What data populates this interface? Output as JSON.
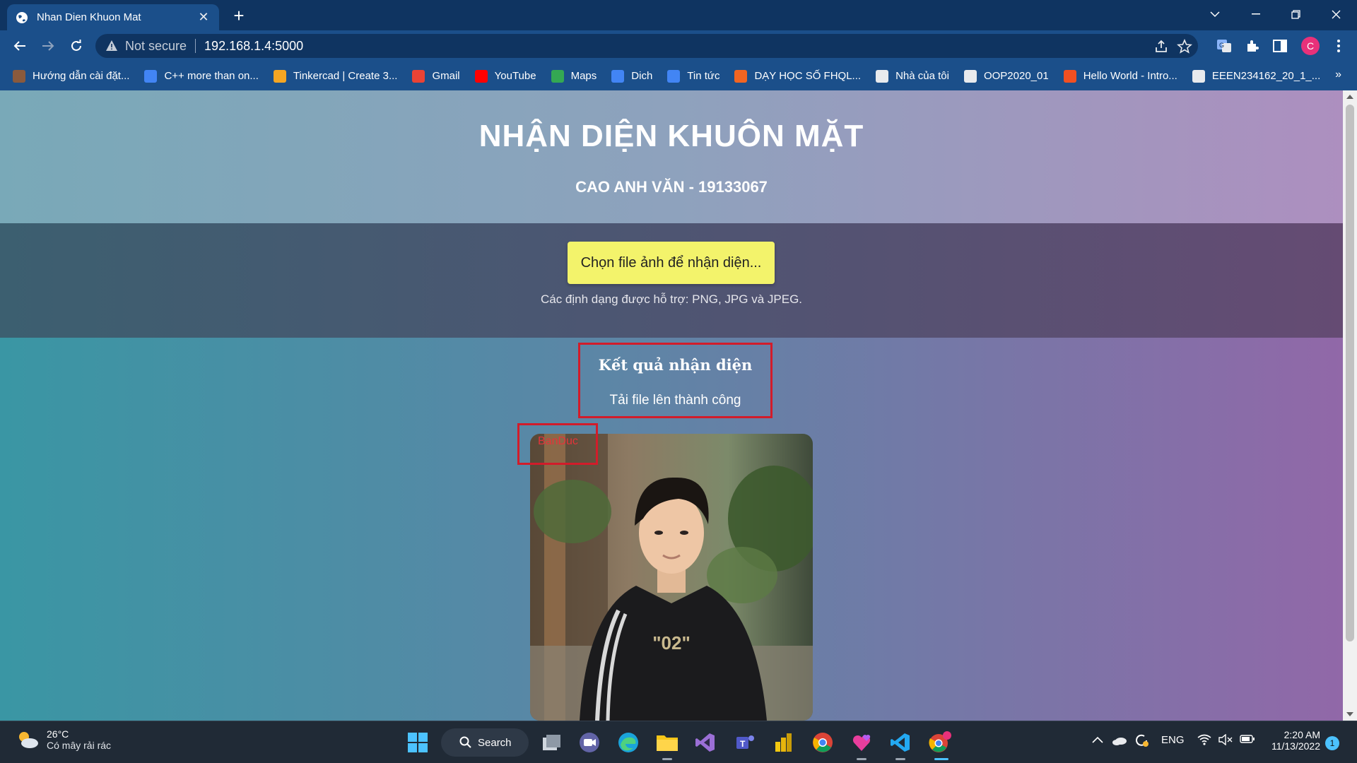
{
  "browser": {
    "tab_title": "Nhan Dien Khuon Mat",
    "security_label": "Not secure",
    "url": "192.168.1.4:5000",
    "profile_initial": "C"
  },
  "bookmarks": [
    {
      "label": "Hướng dẫn cài đặt...",
      "icon": "avatar-icon",
      "color": "#8a5a3c"
    },
    {
      "label": "C++ more than on...",
      "icon": "search-icon",
      "color": "#4285f4"
    },
    {
      "label": "Tinkercad | Create 3...",
      "icon": "tinkercad-icon",
      "color": "#f5a623"
    },
    {
      "label": "Gmail",
      "icon": "gmail-icon",
      "color": "#ea4335"
    },
    {
      "label": "YouTube",
      "icon": "youtube-icon",
      "color": "#ff0000"
    },
    {
      "label": "Maps",
      "icon": "maps-icon",
      "color": "#34a853"
    },
    {
      "label": "Dich",
      "icon": "translate-icon",
      "color": "#4285f4"
    },
    {
      "label": "Tin tức",
      "icon": "news-icon",
      "color": "#4285f4"
    },
    {
      "label": "DẠY HỌC SỐ FHQL...",
      "icon": "fhql-icon",
      "color": "#f26522"
    },
    {
      "label": "Nhà của tôi",
      "icon": "ute-icon",
      "color": "#e8eaed"
    },
    {
      "label": "OOP2020_01",
      "icon": "ute-icon",
      "color": "#e8eaed"
    },
    {
      "label": "Hello World - Intro...",
      "icon": "microsoft-icon",
      "color": "#f25022"
    },
    {
      "label": "EEEN234162_20_1_...",
      "icon": "ute-icon",
      "color": "#e8eaed"
    }
  ],
  "page": {
    "title": "NHẬN DIỆN KHUÔN MẶT",
    "subtitle": "CAO ANH VĂN - 19133067",
    "upload_button": "Chọn file ảnh để nhận diện...",
    "formats_note": "Các định dạng được hỗ trợ: PNG, JPG và JPEG.",
    "result_title": "Kết quả nhận diện",
    "result_message": "Tải file lên thành công",
    "detected_name": "BanDuc"
  },
  "taskbar": {
    "temperature": "26°C",
    "weather_desc": "Có mây rải rác",
    "search_label": "Search",
    "language": "ENG",
    "time": "2:20 AM",
    "date": "11/13/2022",
    "notification_count": "1"
  },
  "colors": {
    "highlight_border": "#d21c2a",
    "upload_button": "#f3f36b",
    "chrome_tab_bar": "#0f3461",
    "chrome_toolbar": "#1b4f8a"
  }
}
